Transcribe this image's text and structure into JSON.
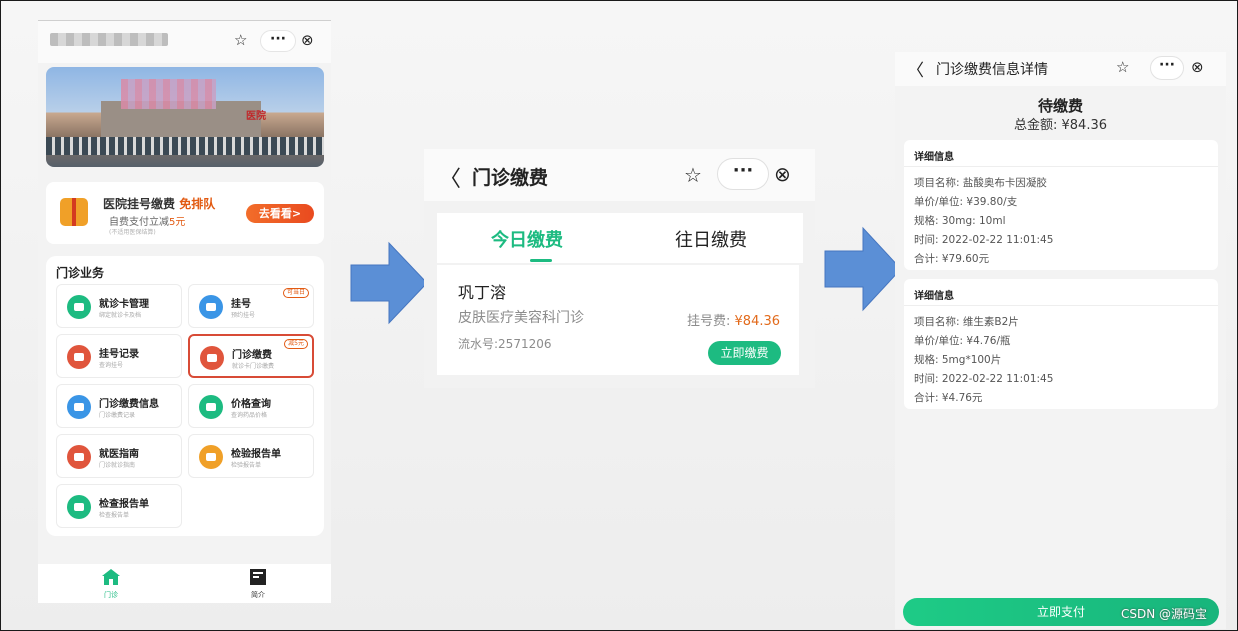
{
  "panel_home": {
    "services_title": "门诊业务",
    "promo": {
      "title": "医院挂号缴费",
      "highlight": "免排队",
      "subtitle_prefix": "自费支付立减",
      "subtitle_amount": "5元",
      "fine_print": "(不适用医保结算)",
      "button": "去看看>"
    },
    "sign_text": "医院",
    "services": [
      {
        "name": "就诊卡管理",
        "desc": "绑定就诊卡及档",
        "color": "#1dbb81",
        "icon": "card-icon",
        "tag": ""
      },
      {
        "name": "挂号",
        "desc": "预约挂号",
        "color": "#3a95e6",
        "icon": "clock-icon",
        "tag": "可当日"
      },
      {
        "name": "挂号记录",
        "desc": "查询挂号",
        "color": "#e0553c",
        "icon": "record-icon",
        "tag": ""
      },
      {
        "name": "门诊缴费",
        "desc": "就诊卡门诊缴费",
        "color": "#e0553c",
        "icon": "wallet-icon",
        "tag": "减5元"
      },
      {
        "name": "门诊缴费信息",
        "desc": "门诊缴费记录",
        "color": "#3a95e6",
        "icon": "list-icon",
        "tag": ""
      },
      {
        "name": "价格查询",
        "desc": "查询药品价格",
        "color": "#1dbb81",
        "icon": "price-icon",
        "tag": ""
      },
      {
        "name": "就医指南",
        "desc": "门诊就诊指南",
        "color": "#e0553c",
        "icon": "guide-icon",
        "tag": ""
      },
      {
        "name": "检验报告单",
        "desc": "检验报告单",
        "color": "#f0a028",
        "icon": "report-icon",
        "tag": ""
      },
      {
        "name": "检查报告单",
        "desc": "检查报告单",
        "color": "#1dbb81",
        "icon": "exam-icon",
        "tag": ""
      }
    ],
    "tabbar": [
      {
        "label": "门诊",
        "icon": "home-icon"
      },
      {
        "label": "简介",
        "icon": "intro-icon"
      }
    ]
  },
  "panel_fee": {
    "title": "门诊缴费",
    "tabs": [
      "今日缴费",
      "往日缴费"
    ],
    "record": {
      "patient": "巩丁溶",
      "department": "皮肤医疗美容科门诊",
      "serial": "流水号:2571206",
      "fee_label": "挂号费:",
      "fee_value": "¥84.36",
      "pay_button": "立即缴费"
    }
  },
  "panel_detail": {
    "title": "门诊缴费信息详情",
    "status": "待缴费",
    "total": "总金额: ¥84.36",
    "cards": [
      {
        "header": "详细信息",
        "rows": [
          "项目名称: 盐酸奥布卡因凝胶",
          "单价/单位: ¥39.80/支",
          "规格: 30mg: 10ml",
          "时间: 2022-02-22 11:01:45",
          "合计: ¥79.60元"
        ]
      },
      {
        "header": "详细信息",
        "rows": [
          "项目名称: 维生素B2片",
          "单价/单位: ¥4.76/瓶",
          "规格: 5mg*100片",
          "时间: 2022-02-22 11:01:45",
          "合计: ¥4.76元"
        ]
      }
    ],
    "pay_button": "立即支付"
  },
  "watermark": "CSDN @源码宝",
  "colors": {
    "accent": "#1dbb81",
    "arrow": "#5b8fd6",
    "price": "#e26a1b",
    "highlight_border": "#d84b36"
  }
}
